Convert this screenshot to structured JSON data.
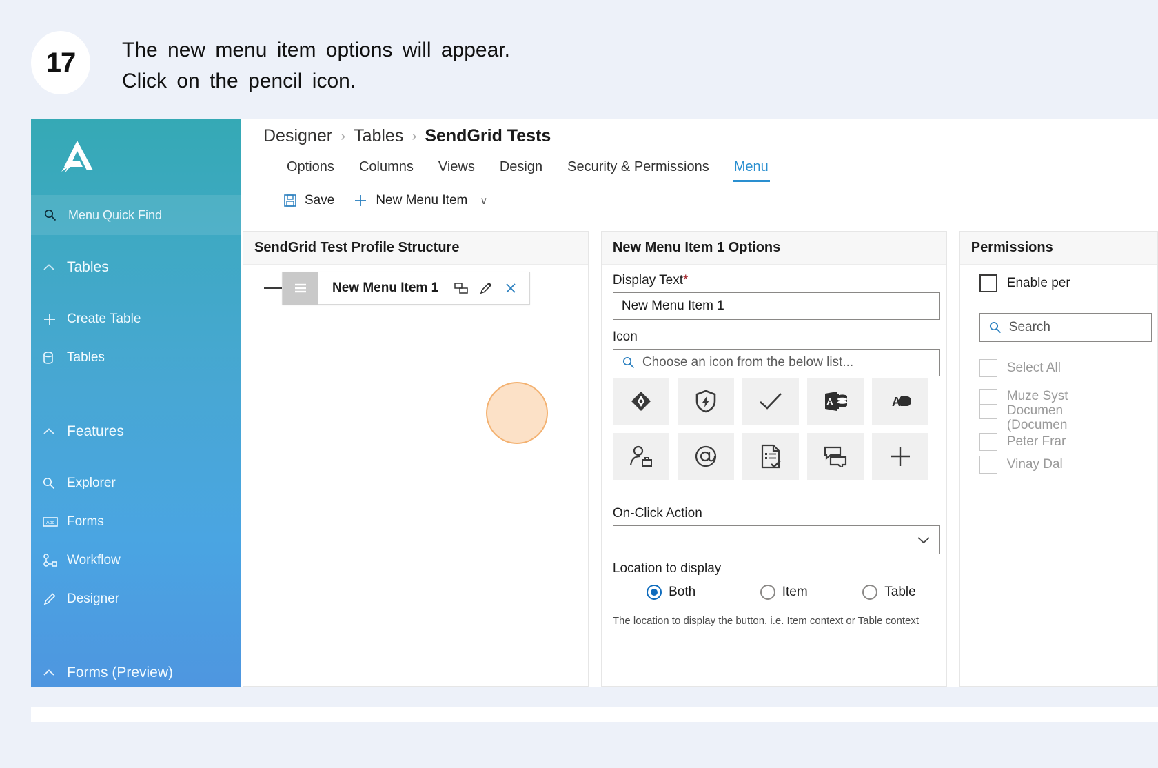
{
  "callout": {
    "step_number": "17",
    "line1": "The new menu item options will appear.",
    "line2": "Click on the pencil icon."
  },
  "sidebar": {
    "logo_name": "appsheet-logo",
    "quick_find": {
      "label": "Menu Quick Find",
      "icon": "search-icon"
    },
    "groups": [
      {
        "label": "Tables",
        "icon": "chevron-up-icon",
        "items": [
          {
            "label": "Create Table",
            "icon": "plus-icon"
          },
          {
            "label": "Tables",
            "icon": "database-icon"
          }
        ]
      },
      {
        "label": "Features",
        "icon": "chevron-up-icon",
        "items": [
          {
            "label": "Explorer",
            "icon": "search-icon"
          },
          {
            "label": "Forms",
            "icon": "abc-textbox-icon"
          },
          {
            "label": "Workflow",
            "icon": "workflow-icon"
          },
          {
            "label": "Designer",
            "icon": "pencil-icon"
          }
        ]
      },
      {
        "label": "Forms (Preview)",
        "icon": "chevron-up-icon",
        "items": []
      }
    ]
  },
  "breadcrumb": {
    "items": [
      "Designer",
      "Tables",
      "SendGrid Tests"
    ],
    "separator": "›"
  },
  "tabs": {
    "items": [
      {
        "label": "Options",
        "active": false
      },
      {
        "label": "Columns",
        "active": false
      },
      {
        "label": "Views",
        "active": false
      },
      {
        "label": "Design",
        "active": false
      },
      {
        "label": "Security & Permissions",
        "active": false
      },
      {
        "label": "Menu",
        "active": true
      }
    ],
    "active_color": "#2a8fd0"
  },
  "command_bar": {
    "save": {
      "label": "Save",
      "icon": "save-disk-icon"
    },
    "new_menu_item": {
      "label": "New Menu Item",
      "icon": "plus-icon",
      "chevron": "∨"
    }
  },
  "structure_panel": {
    "title": "SendGrid Test Profile Structure",
    "menu_item": {
      "label": "New Menu Item 1",
      "handle_icon": "hamburger-drag-handle-icon",
      "actions": [
        {
          "name": "duplicate-icon"
        },
        {
          "name": "pencil-edit-icon"
        },
        {
          "name": "close-remove-icon"
        }
      ]
    },
    "highlight": "pencil-edit-icon"
  },
  "options_panel": {
    "title": "New Menu Item 1 Options",
    "display_text": {
      "label": "Display Text",
      "required_marker": "*",
      "value": "New Menu Item 1"
    },
    "icon_field": {
      "label": "Icon",
      "placeholder": "Choose an icon from the below list...",
      "search_icon": "search-icon",
      "choices": [
        {
          "name": "diamond-arrows-icon"
        },
        {
          "name": "shield-lightning-icon"
        },
        {
          "name": "checkmark-icon"
        },
        {
          "name": "access-database-icon"
        },
        {
          "name": "annotation-a-icon"
        },
        {
          "name": "person-briefcase-icon"
        },
        {
          "name": "at-sign-icon"
        },
        {
          "name": "document-checklist-icon"
        },
        {
          "name": "chat-messages-icon"
        },
        {
          "name": "plus-icon"
        }
      ]
    },
    "on_click_action": {
      "label": "On-Click Action",
      "value": "",
      "chevron": "∨"
    },
    "location_to_display": {
      "label": "Location to display",
      "options": [
        {
          "label": "Both",
          "selected": true
        },
        {
          "label": "Item",
          "selected": false
        },
        {
          "label": "Table",
          "selected": false
        }
      ],
      "hint": "The location to display the button. i.e. Item context or Table context",
      "accent": "#0f6cbd"
    }
  },
  "permissions_panel": {
    "title": "Permissions",
    "enable_label": "Enable per",
    "search_placeholder": "Search",
    "search_icon": "search-icon",
    "select_all_label": "Select All",
    "entries": [
      {
        "line1": "Muze Syst",
        "line2": "Documen",
        "line3": "(Documen"
      },
      {
        "line1": "Peter Frar"
      },
      {
        "line1": "Vinay Dal"
      }
    ]
  }
}
